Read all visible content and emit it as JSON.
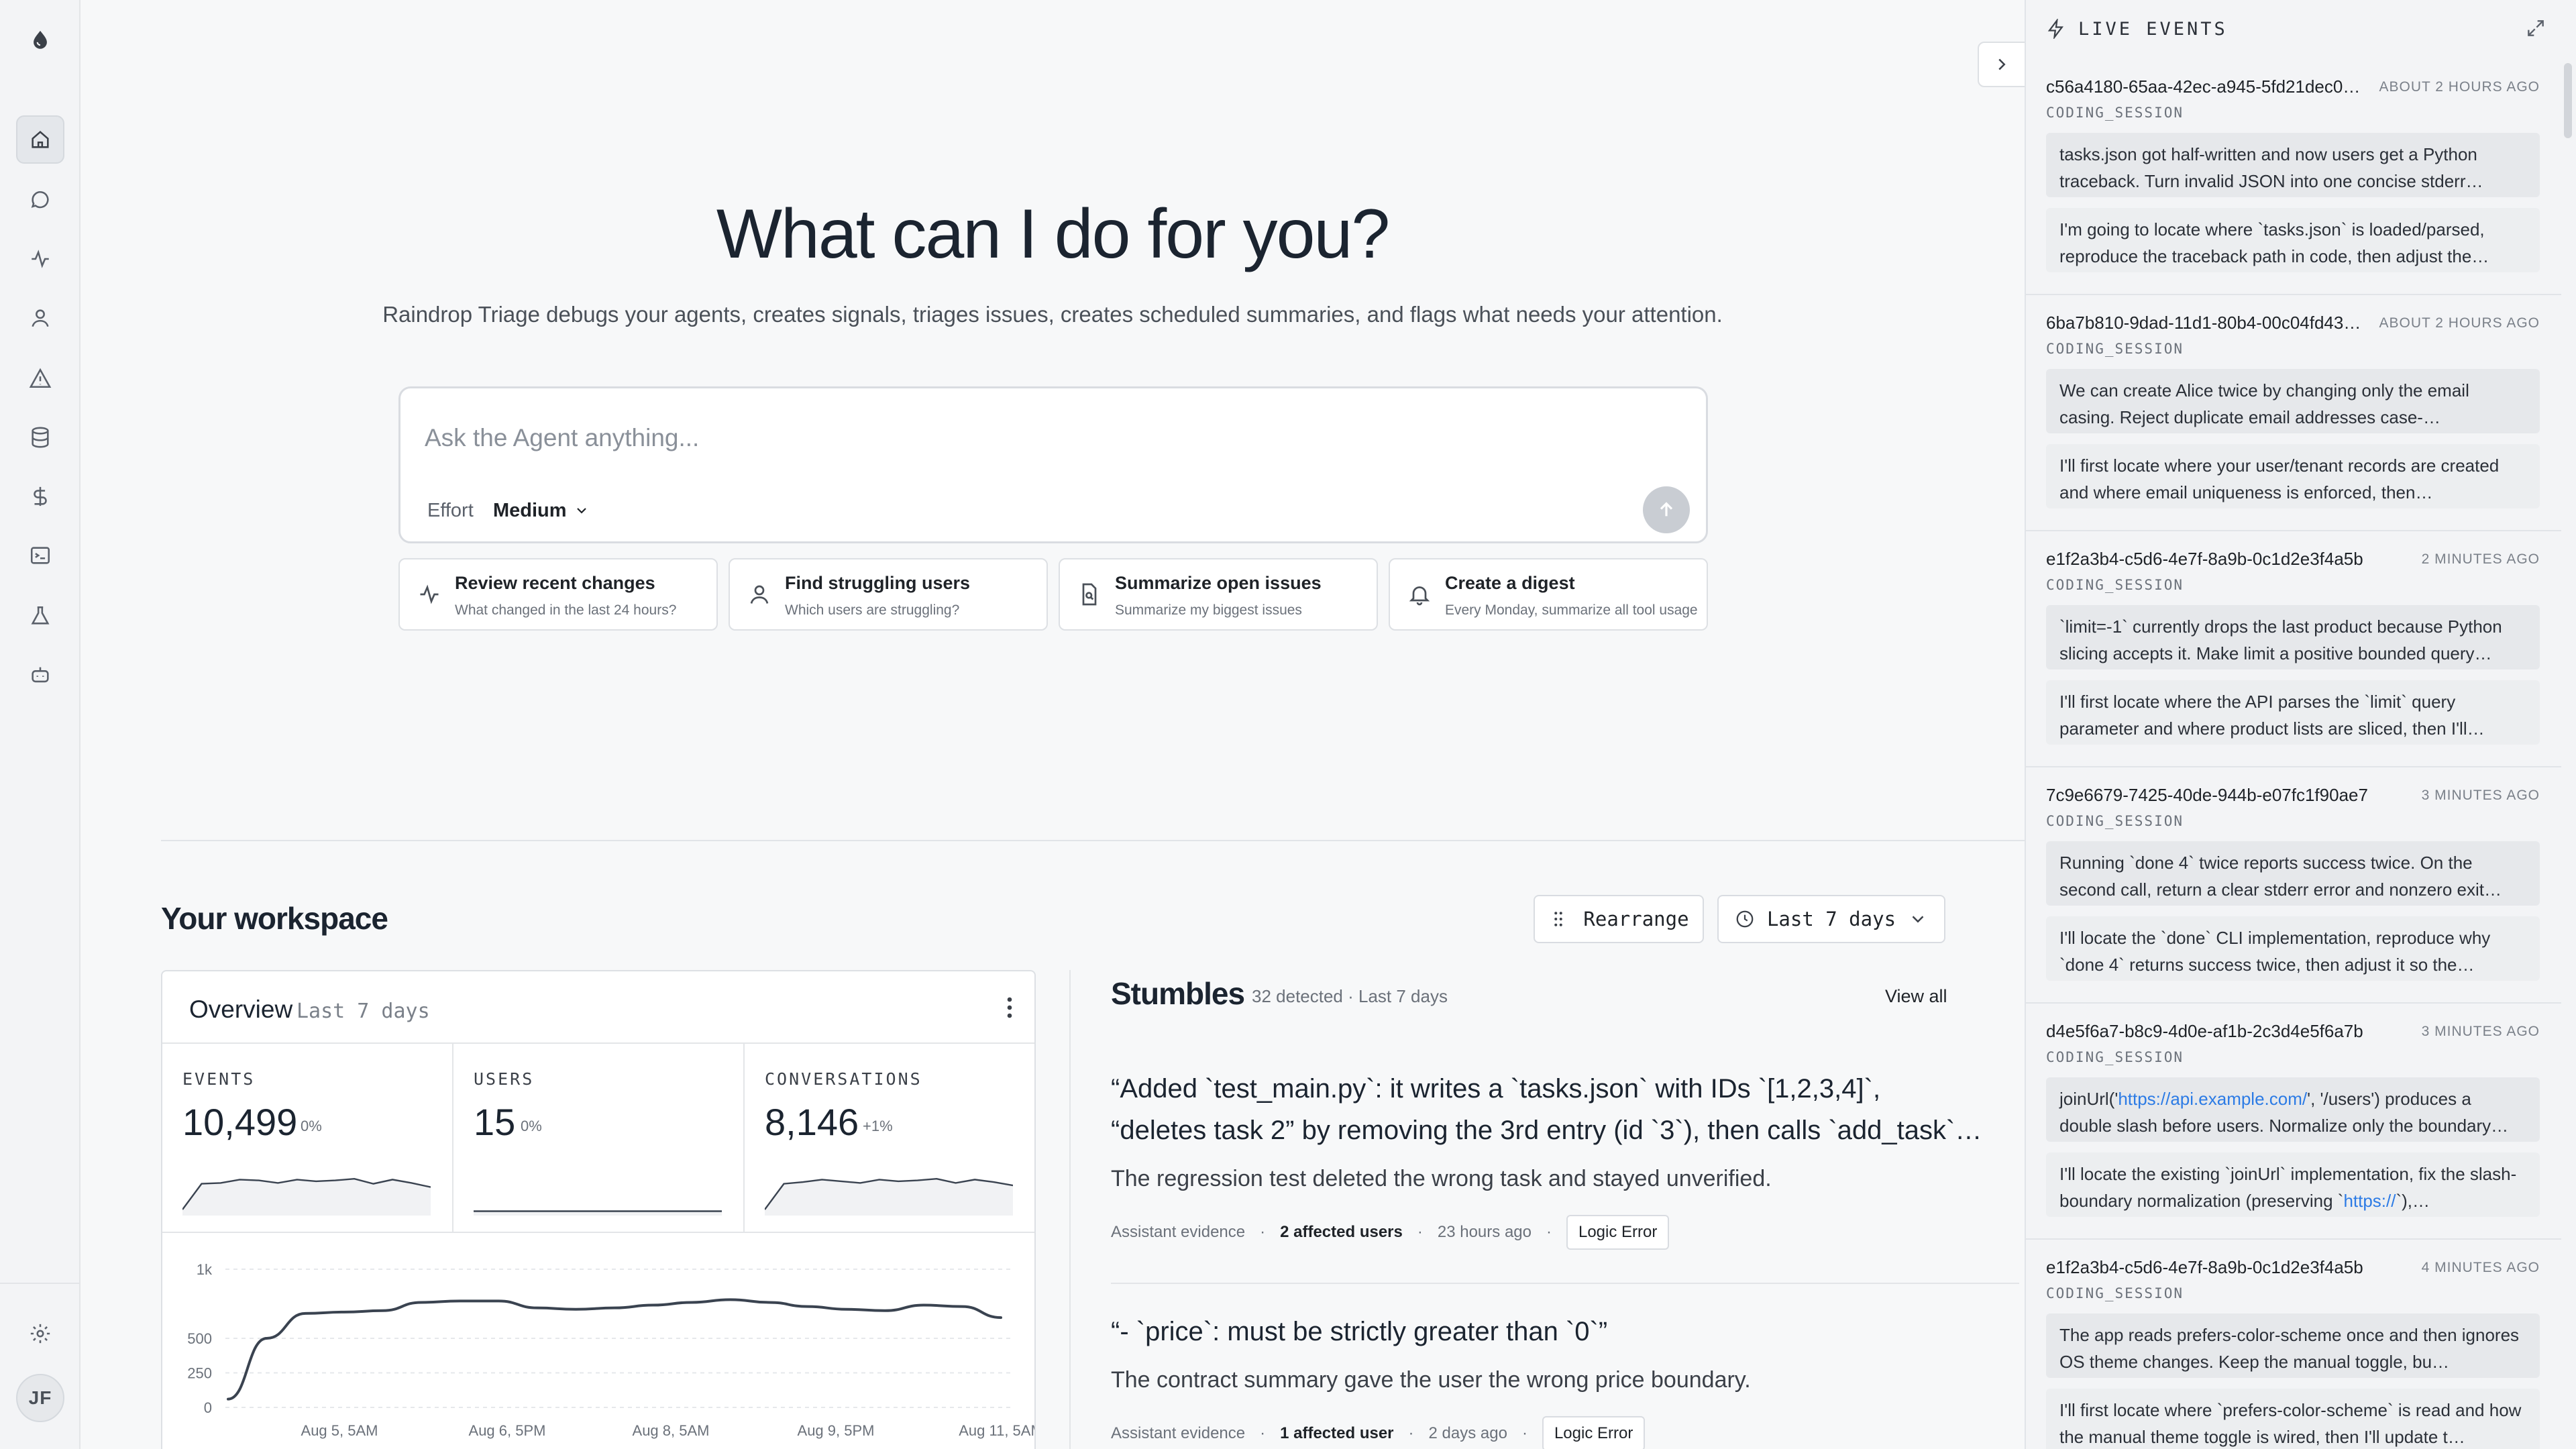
{
  "rail": {
    "avatar_initials": "JF"
  },
  "hero": {
    "title": "What can I do for you?",
    "subtitle": "Raindrop Triage debugs your agents, creates signals, triages issues, creates scheduled summaries, and flags what needs your attention."
  },
  "ask": {
    "placeholder": "Ask the Agent anything...",
    "effort_label": "Effort",
    "effort_value": "Medium"
  },
  "suggestions": [
    {
      "title": "Review recent changes",
      "desc": "What changed in the last 24 hours?"
    },
    {
      "title": "Find struggling users",
      "desc": "Which users are struggling?"
    },
    {
      "title": "Summarize open issues",
      "desc": "Summarize my biggest issues"
    },
    {
      "title": "Create a digest",
      "desc": "Every Monday, summarize all tool usage"
    }
  ],
  "workspace": {
    "title": "Your workspace",
    "rearrange_label": "Rearrange",
    "range_label": "Last 7 days"
  },
  "overview": {
    "title": "Overview",
    "range": "Last 7 days",
    "metrics": [
      {
        "label": "EVENTS",
        "value": "10,499",
        "delta": "0%",
        "spark": [
          8,
          70,
          72,
          80,
          78,
          72,
          80,
          76,
          78,
          82,
          70,
          80,
          72,
          62
        ]
      },
      {
        "label": "USERS",
        "value": "15",
        "delta": "0%",
        "spark": [
          4,
          4,
          4,
          4,
          4,
          4,
          4,
          4,
          4,
          4,
          4,
          4,
          4,
          4
        ]
      },
      {
        "label": "CONVERSATIONS",
        "value": "8,146",
        "delta": "+1%",
        "spark": [
          8,
          70,
          74,
          80,
          76,
          72,
          80,
          76,
          78,
          82,
          72,
          80,
          74,
          66
        ]
      }
    ],
    "chart_data": {
      "type": "line",
      "y_ticks": [
        "1k",
        "500",
        "250",
        "0"
      ],
      "x_ticks": [
        "Aug 5, 5AM",
        "Aug 6, 5PM",
        "Aug 8, 5AM",
        "Aug 9, 5PM",
        "Aug 11, 5AM"
      ],
      "ylim": [
        0,
        1000
      ],
      "values": [
        60,
        500,
        680,
        690,
        700,
        760,
        770,
        770,
        720,
        710,
        720,
        740,
        760,
        780,
        760,
        730,
        710,
        700,
        740,
        730,
        650
      ]
    }
  },
  "stumbles": {
    "title": "Stumbles",
    "meta": "32 detected · Last 7 days",
    "view_all": "View all",
    "items": [
      {
        "quote_line1": "“Added `test_main.py`: it writes a `tasks.json` with IDs `[1,2,3,4]`,",
        "quote_line2": "“deletes task 2” by removing the 3rd entry (id `3`), then calls `add_task`…",
        "desc": "The regression test deleted the wrong task and stayed unverified.",
        "source": "Assistant evidence",
        "affected": "2 affected users",
        "when": "23 hours ago",
        "tag": "Logic Error"
      },
      {
        "quote_line1": "“- `price`: must be strictly greater than `0`”",
        "quote_line2": "",
        "desc": "The contract summary gave the user the wrong price boundary.",
        "source": "Assistant evidence",
        "affected": "1 affected user",
        "when": "2 days ago",
        "tag": "Logic Error"
      }
    ]
  },
  "live_events": {
    "title": "LIVE EVENTS",
    "events": [
      {
        "id": "c56a4180-65aa-42ec-a945-5fd21dec0…",
        "time": "ABOUT 2 HOURS AGO",
        "type": "CODING_SESSION",
        "user_msg": "tasks.json got half-written and now users get a Python traceback. Turn invalid JSON into one concise stderr…",
        "agent_msg": "I'm going to locate where `tasks.json` is loaded/parsed, reproduce the traceback path in code, then adjust the…"
      },
      {
        "id": "6ba7b810-9dad-11d1-80b4-00c04fd43…",
        "time": "ABOUT 2 HOURS AGO",
        "type": "CODING_SESSION",
        "user_msg": "We can create Alice twice by changing only the email casing. Reject duplicate email addresses case-…",
        "agent_msg": "I'll first locate where your user/tenant records are created and where email uniqueness is enforced, then…"
      },
      {
        "id": "e1f2a3b4-c5d6-4e7f-8a9b-0c1d2e3f4a5b",
        "time": "2 MINUTES AGO",
        "type": "CODING_SESSION",
        "user_msg": "`limit=-1` currently drops the last product because Python slicing accepts it. Make limit a positive bounded query…",
        "agent_msg": "I'll first locate where the API parses the `limit` query parameter and where product lists are sliced, then I'll…"
      },
      {
        "id": "7c9e6679-7425-40de-944b-e07fc1f90ae7",
        "time": "3 MINUTES AGO",
        "type": "CODING_SESSION",
        "user_msg": "Running `done 4` twice reports success twice. On the second call, return a clear stderr error and nonzero exit…",
        "agent_msg": "I'll locate the `done` CLI implementation, reproduce why `done 4` returns success twice, then adjust it so the…"
      },
      {
        "id": "d4e5f6a7-b8c9-4d0e-af1b-2c3d4e5f6a7b",
        "time": "3 MINUTES AGO",
        "type": "CODING_SESSION",
        "user_pre": "joinUrl('",
        "user_link": "https://api.example.com/",
        "user_post": "', '/users') produces a double slash before users. Normalize only the boundary…",
        "agent_pre": "I'll locate the existing `joinUrl` implementation, fix the slash-boundary normalization (preserving `",
        "agent_link": "https://",
        "agent_post": "`),…"
      },
      {
        "id": "e1f2a3b4-c5d6-4e7f-8a9b-0c1d2e3f4a5b",
        "time": "4 MINUTES AGO",
        "type": "CODING_SESSION",
        "user_msg": "The app reads prefers-color-scheme once and then ignores OS theme changes. Keep the manual toggle, bu…",
        "agent_msg": "I'll first locate where `prefers-color-scheme` is read and how the manual theme toggle is wired, then I'll update t…"
      }
    ]
  },
  "colors": {
    "accent": "#2c7be5",
    "line": "#3a4350",
    "spark": "#3a4350"
  }
}
